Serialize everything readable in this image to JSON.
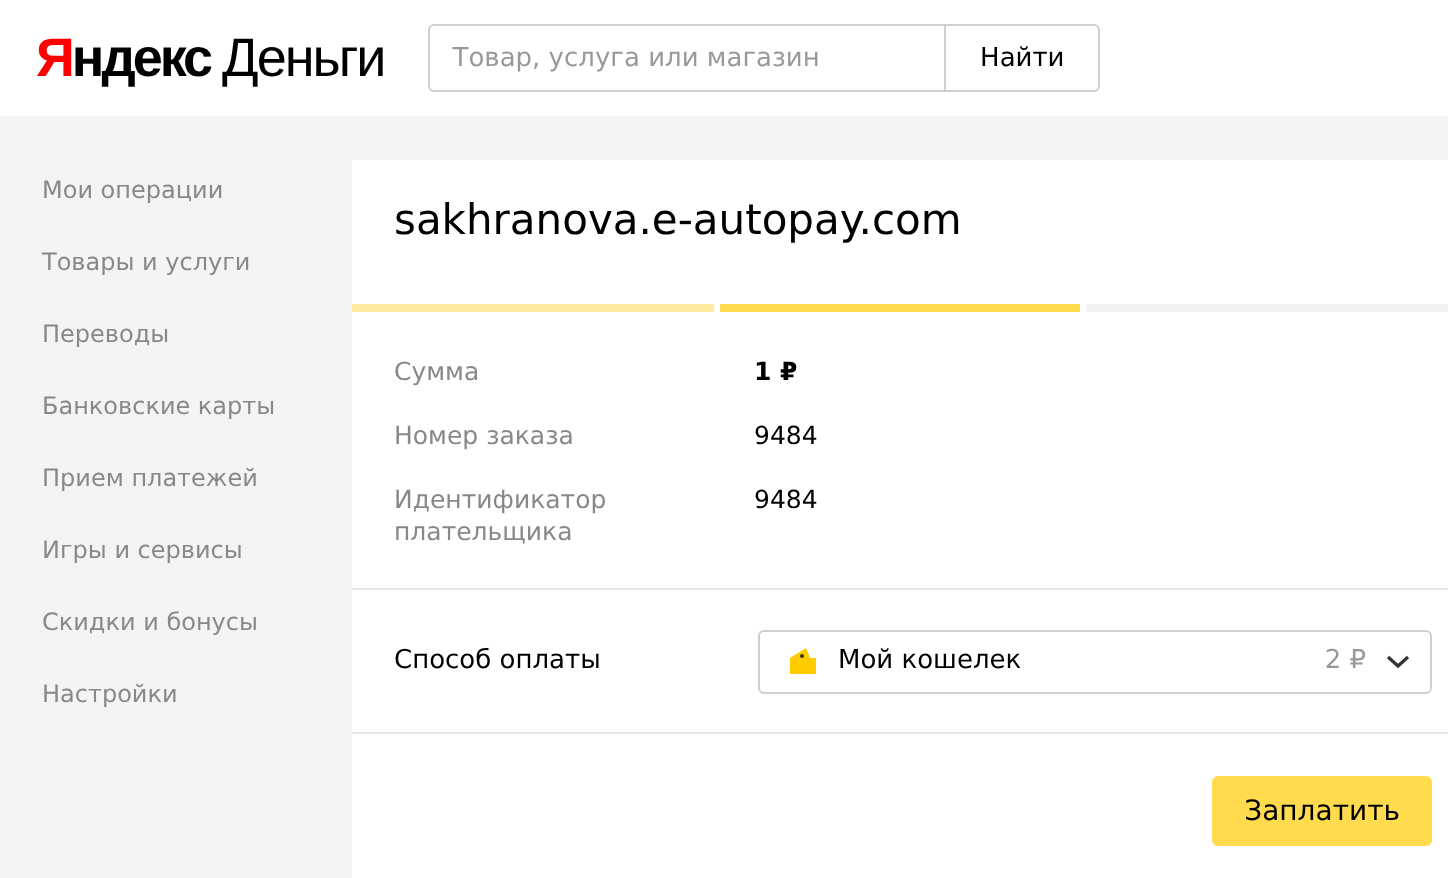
{
  "header": {
    "logo": {
      "brand": "Яндекс",
      "product": "Деньги"
    },
    "search": {
      "placeholder": "Товар, услуга или магазин"
    },
    "search_button": "Найти"
  },
  "sidebar": {
    "items": [
      {
        "label": "Мои операции"
      },
      {
        "label": "Товары и услуги"
      },
      {
        "label": "Переводы"
      },
      {
        "label": "Банковские карты"
      },
      {
        "label": "Прием платежей"
      },
      {
        "label": "Игры и сервисы"
      },
      {
        "label": "Скидки и бонусы"
      },
      {
        "label": "Настройки"
      }
    ]
  },
  "payment": {
    "title": "sakhranova.e-autopay.com",
    "steps": [
      {
        "done": true,
        "selected": false
      },
      {
        "done": false,
        "selected": true
      },
      {
        "done": false,
        "selected": false
      }
    ],
    "details": [
      {
        "label": "Сумма",
        "value": "1 ₽",
        "kind": "amount"
      },
      {
        "label": "Номер заказа",
        "value": "9484",
        "kind": "plain"
      },
      {
        "label": "Идентификатор плательщика",
        "value": "9484",
        "kind": "plain"
      }
    ],
    "method": {
      "label": "Способ оплаты",
      "option": "Мой кошелек",
      "balance": "2 ₽"
    },
    "pay_button": "Заплатить"
  }
}
